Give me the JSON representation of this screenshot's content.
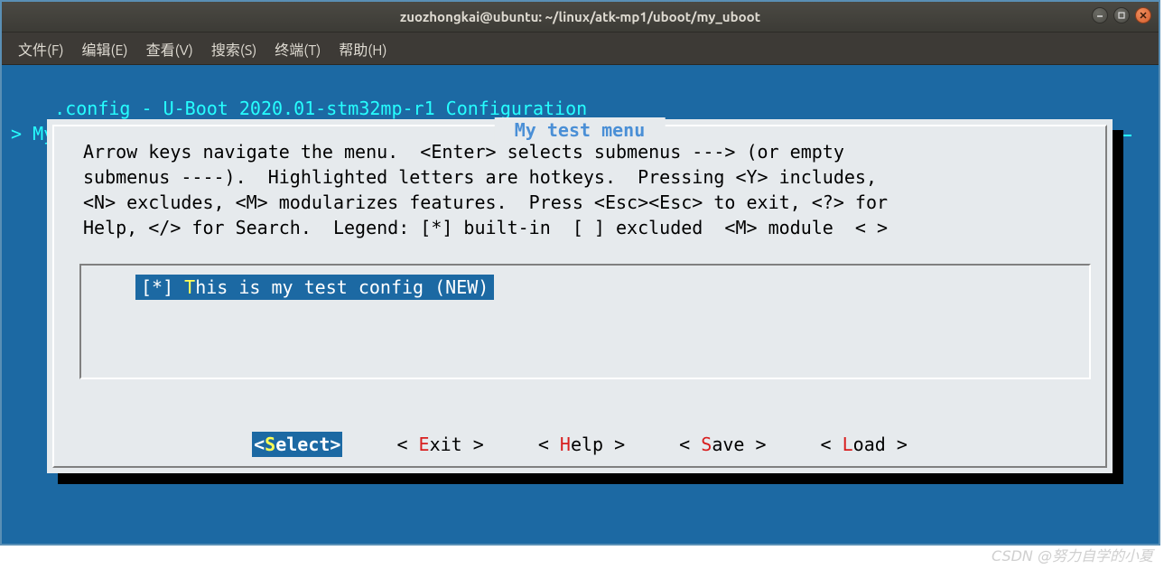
{
  "window": {
    "title": "zuozhongkai@ubuntu: ~/linux/atk-mp1/uboot/my_uboot"
  },
  "menubar": {
    "items": [
      "文件(F)",
      "编辑(E)",
      "查看(V)",
      "搜索(S)",
      "终端(T)",
      "帮助(H)"
    ]
  },
  "header": {
    "config_title": ".config - U-Boot 2020.01-stm32mp-r1 Configuration",
    "breadcrumb": "> My test menu "
  },
  "dialog": {
    "title": " My test menu ",
    "help": "Arrow keys navigate the menu.  <Enter> selects submenus ---> (or empty\nsubmenus ----).  Highlighted letters are hotkeys.  Pressing <Y> includes,\n<N> excludes, <M> modularizes features.  Press <Esc><Esc> to exit, <?> for\nHelp, </> for Search.  Legend: [*] built-in  [ ] excluded  <M> module  < >",
    "entry": {
      "prefix": "[*] ",
      "hotkey": "T",
      "rest": "his is my test config (NEW)"
    },
    "buttons": [
      {
        "pre": "<",
        "hot": "S",
        "post": "elect>",
        "selected": true
      },
      {
        "pre": "< ",
        "hot": "E",
        "post": "xit >",
        "selected": false
      },
      {
        "pre": "< ",
        "hot": "H",
        "post": "elp >",
        "selected": false
      },
      {
        "pre": "< ",
        "hot": "S",
        "post": "ave >",
        "selected": false
      },
      {
        "pre": "< ",
        "hot": "L",
        "post": "oad >",
        "selected": false
      }
    ]
  },
  "watermark": "CSDN @努力自学的小夏"
}
